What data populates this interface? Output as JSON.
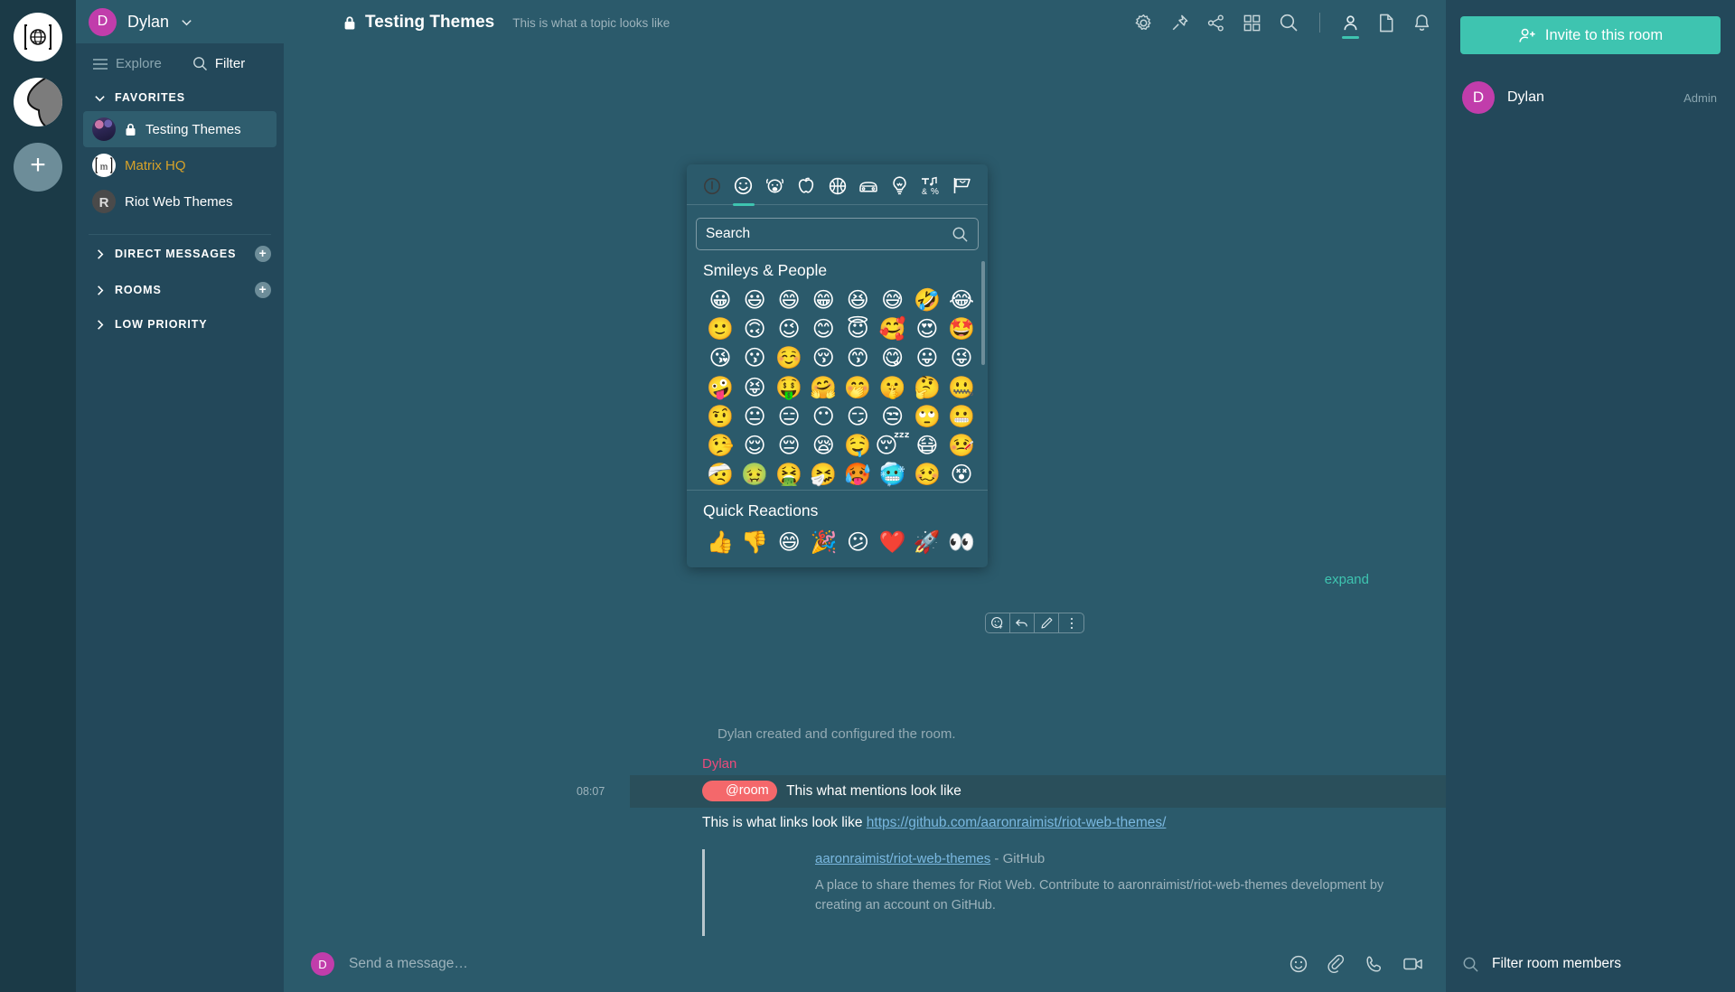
{
  "app": {
    "user": {
      "name": "Dylan",
      "initial": "D"
    },
    "rail": [
      {
        "name": "home-space",
        "icon": "globe-icon"
      },
      {
        "name": "community-space",
        "icon": "community-icon"
      },
      {
        "name": "add-space",
        "icon": "plus-icon",
        "label": "+"
      }
    ]
  },
  "sidebar": {
    "explore_label": "Explore",
    "filter_label": "Filter",
    "sections": [
      {
        "label": "FAVORITES",
        "expanded": true,
        "has_add": false,
        "rooms": [
          {
            "name": "Testing Themes",
            "selected": true,
            "encrypted": true,
            "style": "plain",
            "avatar": "themes"
          },
          {
            "name": "Matrix HQ",
            "selected": false,
            "encrypted": false,
            "style": "gold",
            "avatar": "matrix"
          },
          {
            "name": "Riot Web Themes",
            "selected": false,
            "encrypted": false,
            "style": "plain",
            "avatar": "riot"
          }
        ]
      },
      {
        "label": "DIRECT MESSAGES",
        "expanded": false,
        "has_add": true,
        "rooms": []
      },
      {
        "label": "ROOMS",
        "expanded": false,
        "has_add": true,
        "rooms": []
      },
      {
        "label": "LOW PRIORITY",
        "expanded": false,
        "has_add": false,
        "rooms": []
      }
    ]
  },
  "room_header": {
    "title": "Testing Themes",
    "topic": "This is what a topic looks like",
    "encrypted": true,
    "icons": [
      "gear-icon",
      "pin-icon",
      "share-icon",
      "apps-icon",
      "search-icon",
      "divider",
      "member-list-icon",
      "files-icon",
      "notifications-icon"
    ],
    "active_icon": "member-list-icon"
  },
  "timeline": {
    "system_event": "Dylan created and configured the room.",
    "event": {
      "sender": "Dylan",
      "timestamp": "08:07",
      "mention_pill": "@room",
      "mention_text": "This what mentions look like",
      "link_line_prefix": "This is what links look like",
      "link_url": "https://github.com/aaronraimist/riot-web-themes/"
    },
    "preview": {
      "title": "aaronraimist/riot-web-themes",
      "site": "- GitHub",
      "description": "A place to share themes for Riot Web. Contribute to aaronraimist/riot-web-themes development by creating an account on GitHub."
    },
    "expand_label": "expand",
    "hover_actions": [
      "react-icon",
      "reply-icon",
      "edit-icon",
      "options-icon"
    ]
  },
  "composer": {
    "placeholder": "Send a message…",
    "avatar_initial": "D",
    "icons": [
      "emoji-icon",
      "attachment-icon",
      "voice-call-icon",
      "video-call-icon"
    ]
  },
  "right_panel": {
    "invite_label": "Invite to this room",
    "members": [
      {
        "name": "Dylan",
        "initial": "D",
        "role": "Admin"
      }
    ],
    "filter_placeholder": "Filter room members"
  },
  "emoji_picker": {
    "tabs": [
      {
        "name": "recent",
        "icon": "clock-icon",
        "active": false
      },
      {
        "name": "smileys-people",
        "icon": "smiley-icon",
        "active": true
      },
      {
        "name": "animals-nature",
        "icon": "dog-icon",
        "active": false
      },
      {
        "name": "food-drink",
        "icon": "apple-icon",
        "active": false
      },
      {
        "name": "activity",
        "icon": "ball-icon",
        "active": false
      },
      {
        "name": "travel-places",
        "icon": "car-icon",
        "active": false
      },
      {
        "name": "objects",
        "icon": "bulb-icon",
        "active": false
      },
      {
        "name": "symbols",
        "icon": "symbols-icon",
        "active": false
      },
      {
        "name": "flags",
        "icon": "flag-icon",
        "active": false
      }
    ],
    "search_placeholder": "Search",
    "category_label": "Smileys & People",
    "emojis": [
      "😀",
      "😃",
      "😄",
      "😁",
      "😆",
      "😅",
      "🤣",
      "😂",
      "🙂",
      "🙃",
      "😉",
      "😊",
      "😇",
      "🥰",
      "😍",
      "🤩",
      "😘",
      "😗",
      "☺️",
      "😚",
      "😙",
      "😋",
      "😛",
      "😜",
      "🤪",
      "😝",
      "🤑",
      "🤗",
      "🤭",
      "🤫",
      "🤔",
      "🤐",
      "🤨",
      "😐",
      "😑",
      "😶",
      "😏",
      "😒",
      "🙄",
      "😬",
      "🤥",
      "😌",
      "😔",
      "😪",
      "🤤",
      "😴",
      "😷",
      "🤒",
      "🤕",
      "🤢",
      "🤮",
      "🤧",
      "🥵",
      "🥶",
      "🥴",
      "😵"
    ],
    "quick_label": "Quick Reactions",
    "quick_emojis": [
      "👍",
      "👎",
      "😄",
      "🎉",
      "😕",
      "❤️",
      "🚀",
      "👀"
    ]
  },
  "colors": {
    "accent": "#3ec4b0",
    "background": "#2b5a6b",
    "sidebar": "#23485a",
    "rail": "#1b3a47",
    "sender": "#ec4b7c",
    "link": "#7ab8e0",
    "mention_pill": "#f4686b",
    "gold_room": "#d7a229",
    "avatar_magenta": "#c13dab"
  }
}
